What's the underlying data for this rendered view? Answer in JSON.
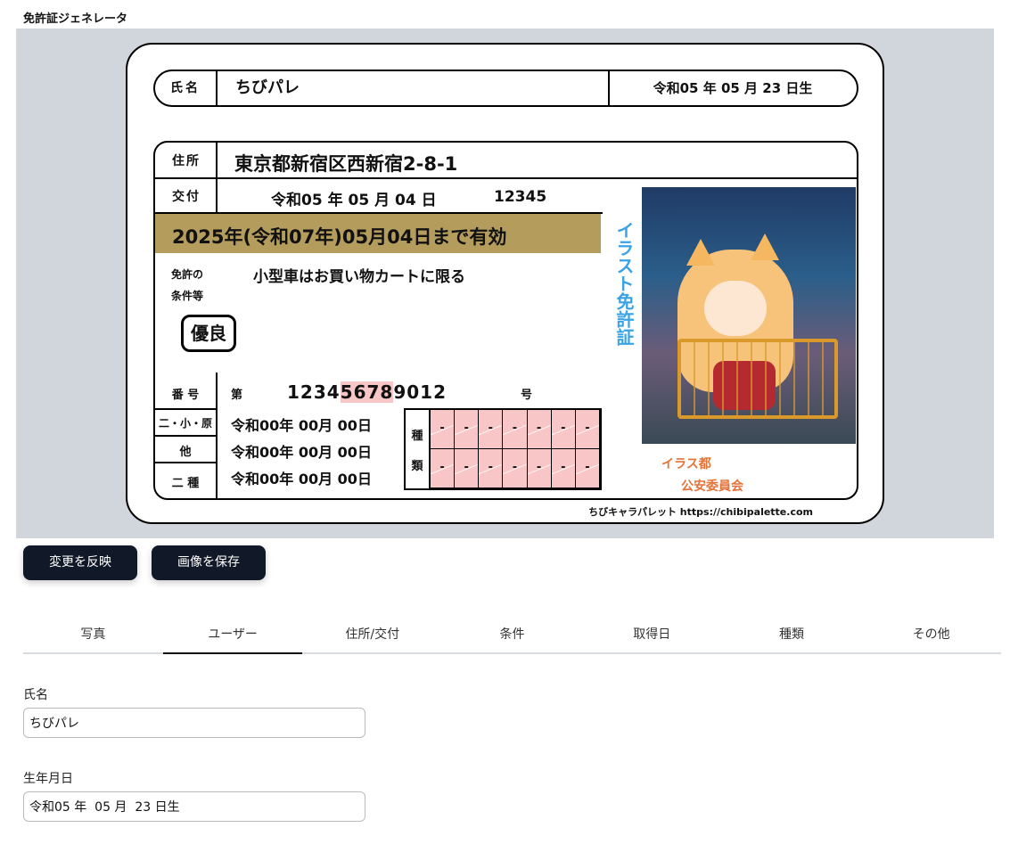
{
  "app_title": "免許証ジェネレータ",
  "license": {
    "name_label": "氏名",
    "name": "ちびパレ",
    "birth_date": "令和05 年 05 月 23 日生",
    "address_label": "住所",
    "address": "東京都新宿区西新宿2-8-1",
    "issue_label": "交付",
    "issue_date": "令和05 年 05 月 04 日",
    "issue_number": "12345",
    "valid_until": "2025年(令和07年)05月04日まで有効",
    "conditions_label_line1": "免許の",
    "conditions_label_line2": "条件等",
    "conditions": "小型車はお買い物カートに限る",
    "excellent_badge": "優良",
    "vertical_title": "イラスト免許証",
    "photo_icon": "anime-cat-girl-photo",
    "authority_line1": "イラス都",
    "authority_line2": "公安委員会",
    "number_label": "番 号",
    "number_prefix": "第",
    "license_number_start": "1234",
    "license_number_highlight": "5678",
    "license_number_end": "9012",
    "number_suffix": "号",
    "category_rows": [
      {
        "label": "二・小・原",
        "date": "令和00年 00月 00日"
      },
      {
        "label": "他",
        "date": "令和00年 00月 00日"
      },
      {
        "label": "二 種",
        "date": "令和00年 00月 00日"
      }
    ],
    "grid_label_top": "種",
    "grid_label_bottom": "類",
    "grid_cells": [
      "-",
      "-",
      "-",
      "-",
      "-",
      "-",
      "-",
      "-",
      "-",
      "-",
      "-",
      "-",
      "-",
      "-"
    ],
    "credit": "ちびキャラパレット https://chibipalette.com",
    "colors": {
      "valid_band": "#b39c5c",
      "vertical_title": "#3aa3e6",
      "authority": "#e4733a",
      "highlight": "#f8c6c6"
    }
  },
  "buttons": {
    "apply": "変更を反映",
    "save": "画像を保存"
  },
  "tabs": [
    "写真",
    "ユーザー",
    "住所/交付",
    "条件",
    "取得日",
    "種類",
    "その他"
  ],
  "active_tab": "ユーザー",
  "form": {
    "name_label": "氏名",
    "name_value": "ちびパレ",
    "birth_label": "生年月日",
    "birth_value": "令和05 年  05 月  23 日生"
  }
}
